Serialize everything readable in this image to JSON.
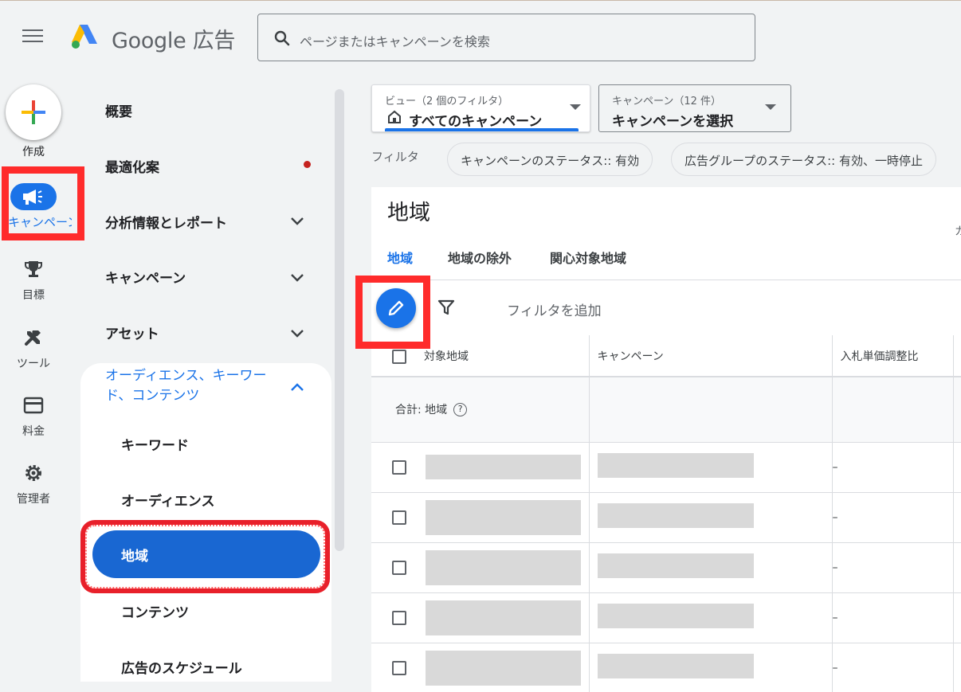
{
  "topbar": {
    "brand_google": "Google",
    "brand_product": "広告",
    "search_placeholder": "ページまたはキャンペーンを検索"
  },
  "rail": {
    "create_label": "作成",
    "campaigns_label": "キャンペーン",
    "goals_label": "目標",
    "tools_label": "ツール",
    "billing_label": "料金",
    "admin_label": "管理者"
  },
  "sidenav": {
    "overview": "概要",
    "recommendations": "最適化案",
    "insights": "分析情報とレポート",
    "campaigns": "キャンペーン",
    "assets": "アセット",
    "audiences_section": "オーディエンス、キーワード、コンテンツ",
    "keywords": "キーワード",
    "audiences": "オーディエンス",
    "locations": "地域",
    "content": "コンテンツ",
    "ad_schedule": "広告のスケジュール"
  },
  "filters": {
    "view_caption": "ビュー（2 個のフィルタ）",
    "view_value": "すべてのキャンペーン",
    "campaign_caption": "キャンペーン（12 件）",
    "campaign_value": "キャンペーンを選択",
    "filter_label": "フィルタ",
    "chip1": "キャンペーンのステータス:: 有効",
    "chip2": "広告グループのステータス:: 有効、一時停止"
  },
  "page": {
    "title": "地域",
    "cut_text": "カ",
    "tabs": [
      "地域",
      "地域の除外",
      "関心対象地域"
    ],
    "add_filter": "フィルタを追加"
  },
  "table": {
    "headers": [
      "対象地域",
      "キャンペーン",
      "入札単価調整比"
    ],
    "summary": "合計: 地域",
    "help_glyph": "?",
    "rows": [
      {
        "bid": "–"
      },
      {
        "bid": "–"
      },
      {
        "bid": "–"
      },
      {
        "bid": "–"
      },
      {
        "bid": "–"
      }
    ]
  },
  "colors": {
    "accent": "#1a73e8",
    "highlight": "#ff2b2b",
    "background": "#f1f3f4"
  }
}
